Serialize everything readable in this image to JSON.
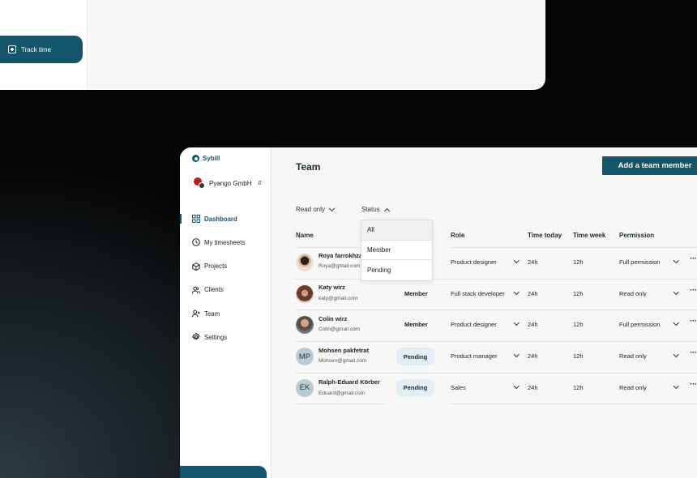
{
  "back_window": {
    "track_time_label": "Track time"
  },
  "app": {
    "name": "Sybill",
    "org": "Pyango GmbH"
  },
  "sidebar": {
    "items": [
      {
        "label": "Dashboard",
        "icon": "grid-icon",
        "active": true
      },
      {
        "label": "My timesheets",
        "icon": "clock-icon",
        "active": false
      },
      {
        "label": "Projects",
        "icon": "cube-icon",
        "active": false
      },
      {
        "label": "Clients",
        "icon": "users-icon",
        "active": false
      },
      {
        "label": "Team",
        "icon": "user-plus-icon",
        "active": false
      },
      {
        "label": "Settings",
        "icon": "gear-icon",
        "active": false
      }
    ]
  },
  "main": {
    "title": "Team",
    "add_button": "Add a team member",
    "filters": {
      "read_only": "Read only",
      "status": "Status"
    },
    "status_dropdown": [
      "All",
      "Member",
      "Pending"
    ],
    "columns": {
      "name": "Name",
      "role": "Role",
      "time_today": "Time today",
      "time_week": "Time week",
      "permission": "Permission"
    },
    "rows": [
      {
        "name": "Roya farrokhzad",
        "email": "Roya@gmail.com",
        "avatar": "photo",
        "status": "",
        "role": "Product designer",
        "time_today": "24h",
        "time_week": "12h",
        "permission": "Full permission"
      },
      {
        "name": "Katy wirz",
        "email": "katy@gmail.com",
        "avatar": "photo",
        "status": "Member",
        "role": "Full stack developer",
        "time_today": "24h",
        "time_week": "12h",
        "permission": "Read only"
      },
      {
        "name": "Colin wirz",
        "email": "Colin@gmail.com",
        "avatar": "photo",
        "status": "Member",
        "role": "Product designer",
        "time_today": "24h",
        "time_week": "12h",
        "permission": "Full permission"
      },
      {
        "name": "Mohsen pakfetrat",
        "email": "Mohsen@gmail.com",
        "avatar": "MP",
        "status": "Pending",
        "role": "Product manager",
        "time_today": "24h",
        "time_week": "12h",
        "permission": "Read only"
      },
      {
        "name": "Ralph-Eduard Körber",
        "email": "Eduard@gmail.com",
        "avatar": "EK",
        "status": "Pending",
        "role": "Sales",
        "time_today": "24h",
        "time_week": "12h",
        "permission": "Read only"
      }
    ]
  },
  "colors": {
    "accent": "#13566b",
    "pending_badge": "#e3edf4"
  }
}
